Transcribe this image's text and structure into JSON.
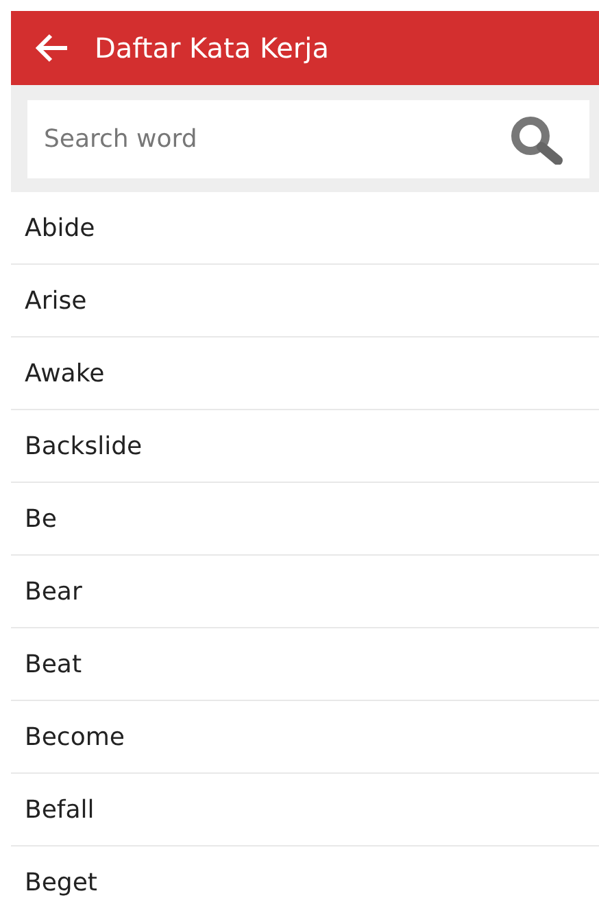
{
  "app_bar": {
    "title": "Daftar Kata Kerja"
  },
  "search": {
    "placeholder": "Search word"
  },
  "words": [
    "Abide",
    "Arise",
    "Awake",
    "Backslide",
    "Be",
    "Bear",
    "Beat",
    "Become",
    "Befall",
    "Beget"
  ]
}
